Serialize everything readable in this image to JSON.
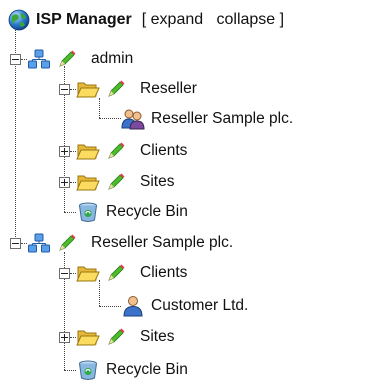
{
  "header": {
    "globe_icon": "globe-icon",
    "title": "ISP Manager",
    "bracket_open": "[",
    "expand_label": "expand",
    "collapse_label": "collapse",
    "bracket_close": "]"
  },
  "tree": {
    "admin": {
      "label": "admin",
      "state": "expanded",
      "icon": "network-icon",
      "reseller_folder": {
        "label": "Reseller",
        "state": "expanded",
        "icon": "folder-open-icon"
      },
      "reseller_sample": {
        "label": "Reseller Sample plc.",
        "icon": "users-icon"
      },
      "clients_folder": {
        "label": "Clients",
        "state": "collapsed",
        "icon": "folder-icon"
      },
      "sites_folder": {
        "label": "Sites",
        "state": "collapsed",
        "icon": "folder-icon"
      },
      "recycle_bin": {
        "label": "Recycle Bin",
        "icon": "recycle-bin-icon"
      }
    },
    "reseller": {
      "label": "Reseller Sample plc.",
      "state": "expanded",
      "icon": "network-icon",
      "clients_folder": {
        "label": "Clients",
        "state": "expanded",
        "icon": "folder-open-icon"
      },
      "customer": {
        "label": "Customer Ltd.",
        "icon": "user-icon"
      },
      "sites_folder": {
        "label": "Sites",
        "state": "collapsed",
        "icon": "folder-icon"
      },
      "recycle_bin": {
        "label": "Recycle Bin",
        "icon": "recycle-bin-icon"
      }
    },
    "edit_icon": "pencil-edit-icon"
  }
}
